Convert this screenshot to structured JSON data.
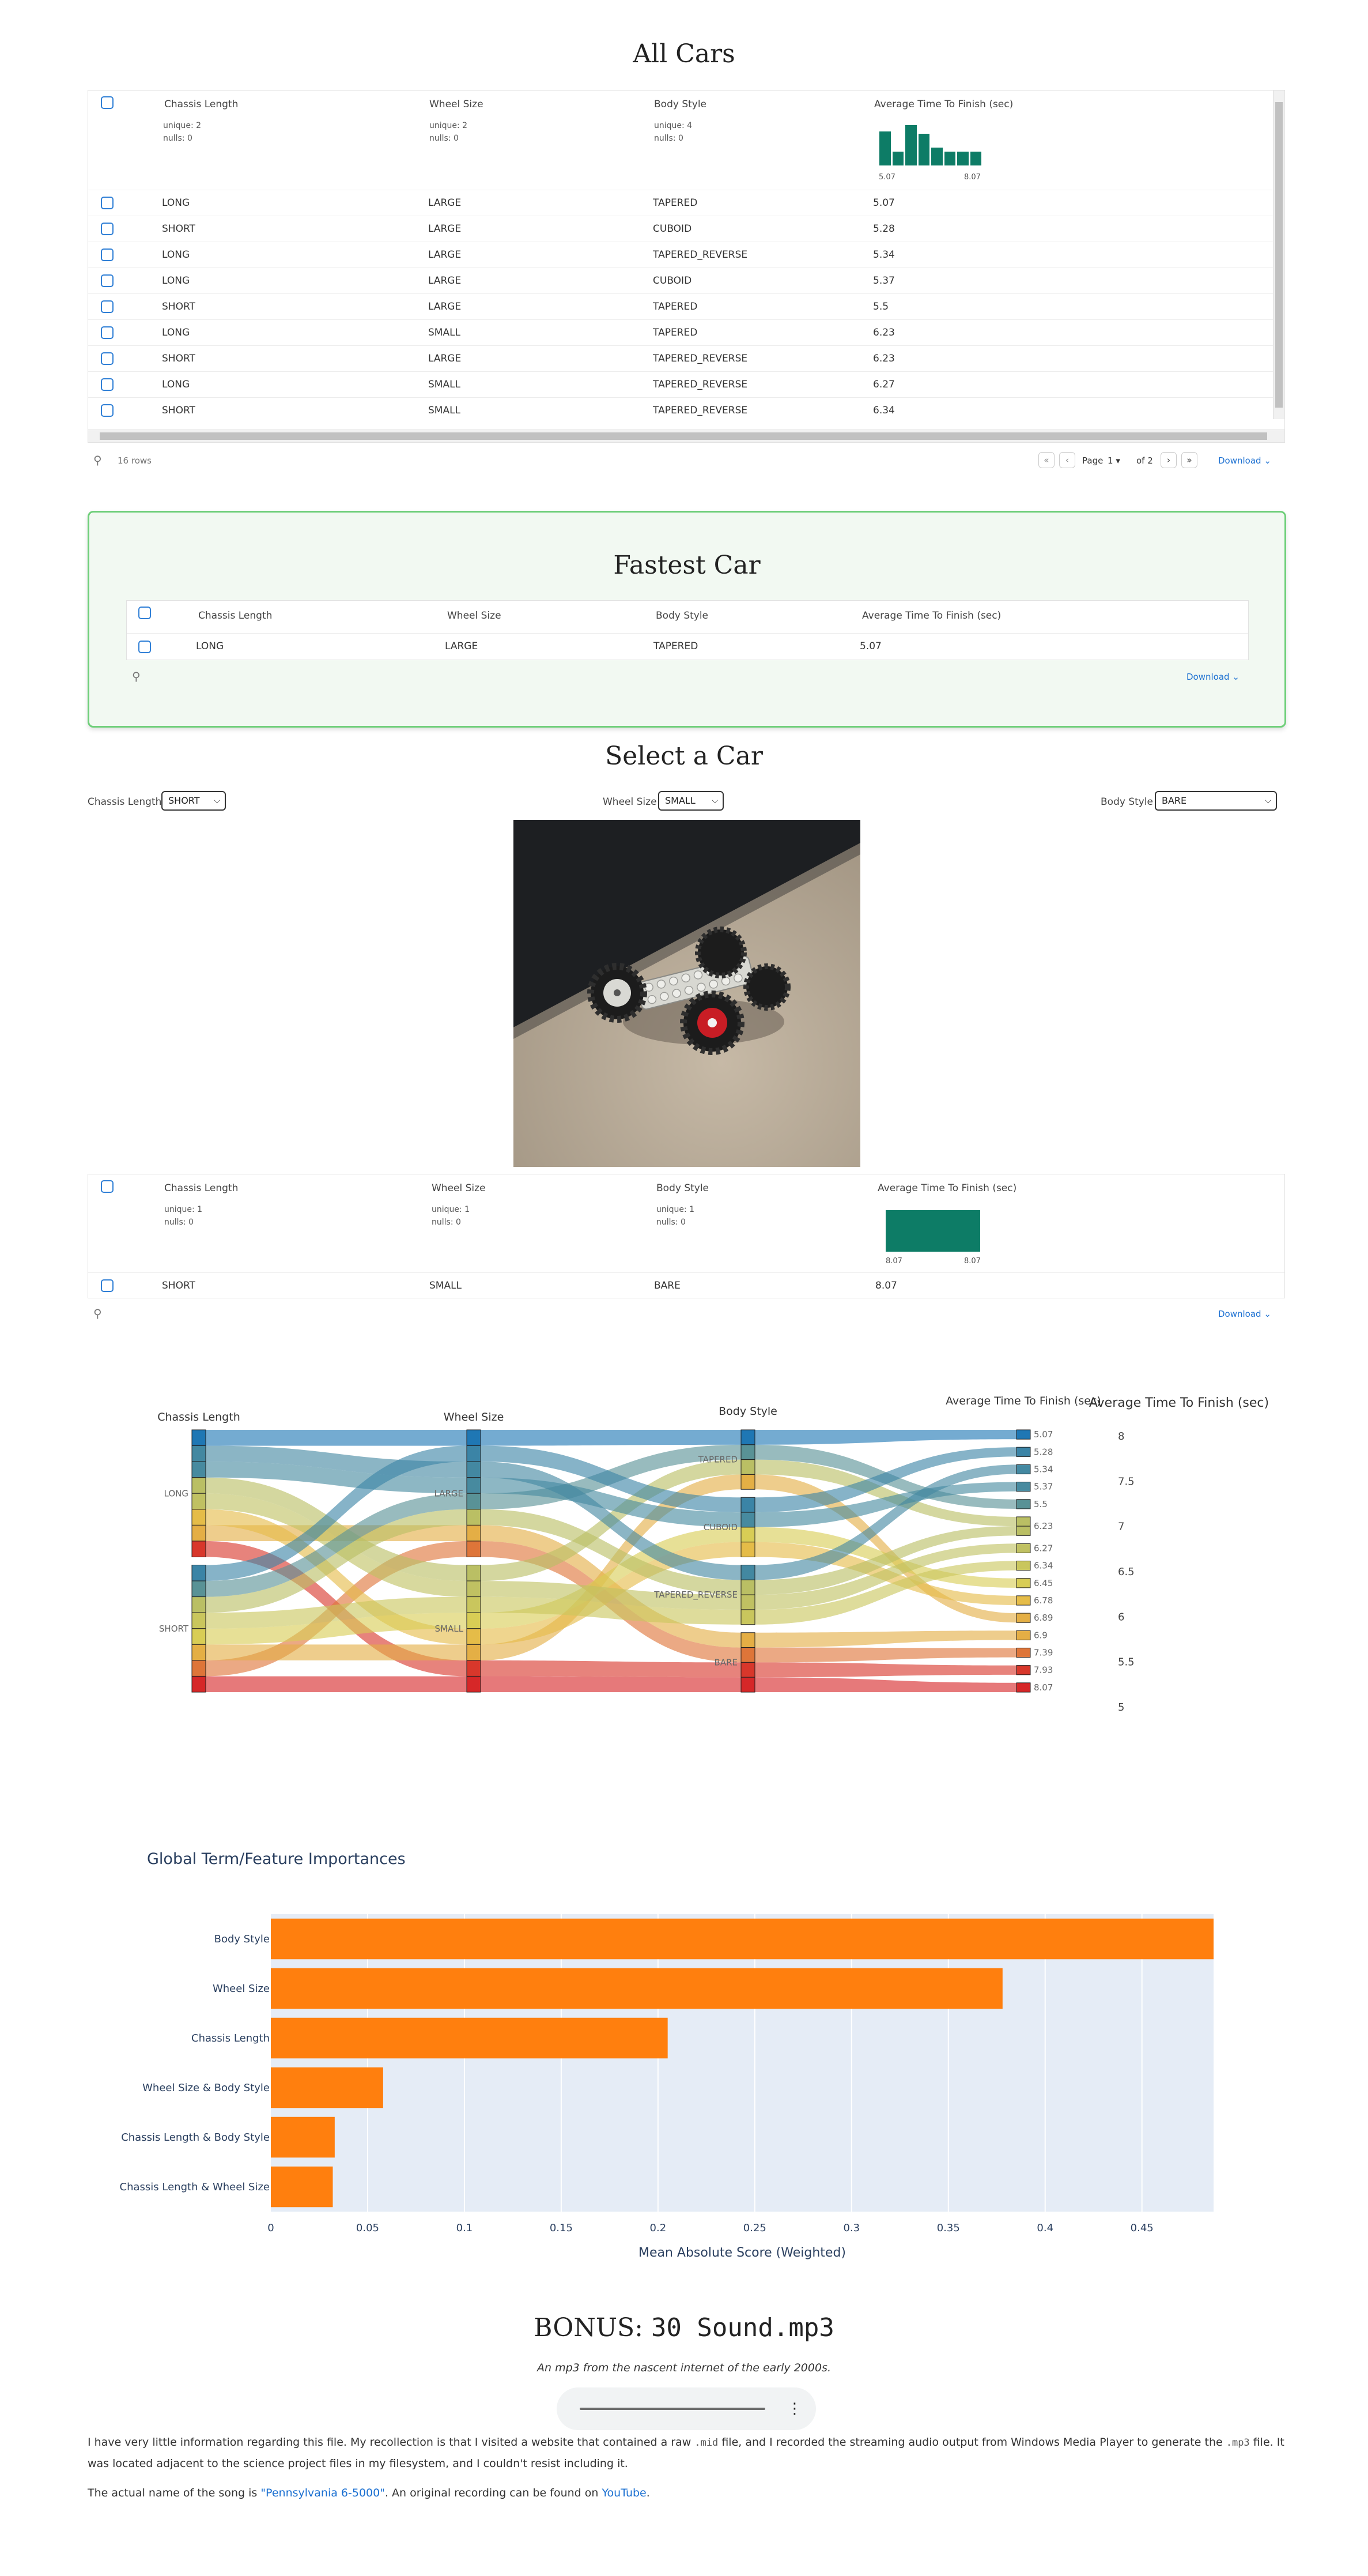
{
  "all_cars": {
    "title": "All Cars",
    "columns": [
      "Chassis Length",
      "Wheel Size",
      "Body Style",
      "Average Time To Finish (sec)"
    ],
    "stats": [
      {
        "unique": "unique: 2",
        "nulls": "nulls: 0"
      },
      {
        "unique": "unique: 2",
        "nulls": "nulls: 0"
      },
      {
        "unique": "unique: 4",
        "nulls": "nulls: 0"
      }
    ],
    "hist_min": "5.07",
    "hist_max": "8.07",
    "hist_bins": [
      0.85,
      0.35,
      1.0,
      0.78,
      0.45,
      0.35,
      0.35,
      0.35
    ],
    "rows": [
      [
        "LONG",
        "LARGE",
        "TAPERED",
        "5.07"
      ],
      [
        "SHORT",
        "LARGE",
        "CUBOID",
        "5.28"
      ],
      [
        "LONG",
        "LARGE",
        "TAPERED_REVERSE",
        "5.34"
      ],
      [
        "LONG",
        "LARGE",
        "CUBOID",
        "5.37"
      ],
      [
        "SHORT",
        "LARGE",
        "TAPERED",
        "5.5"
      ],
      [
        "LONG",
        "SMALL",
        "TAPERED",
        "6.23"
      ],
      [
        "SHORT",
        "LARGE",
        "TAPERED_REVERSE",
        "6.23"
      ],
      [
        "LONG",
        "SMALL",
        "TAPERED_REVERSE",
        "6.27"
      ],
      [
        "SHORT",
        "SMALL",
        "TAPERED_REVERSE",
        "6.34"
      ]
    ],
    "row_count": "16 rows",
    "page_label": "Page",
    "page_value": "1",
    "page_of": "of 2",
    "download": "Download"
  },
  "fastest": {
    "title": "Fastest Car",
    "columns": [
      "Chassis Length",
      "Wheel Size",
      "Body Style",
      "Average Time To Finish (sec)"
    ],
    "rows": [
      [
        "LONG",
        "LARGE",
        "TAPERED",
        "5.07"
      ]
    ],
    "download": "Download"
  },
  "select": {
    "title": "Select a Car",
    "chassis_label": "Chassis Length",
    "chassis_value": "SHORT",
    "wheel_label": "Wheel Size",
    "wheel_value": "SMALL",
    "body_label": "Body Style",
    "body_value": "BARE",
    "columns": [
      "Chassis Length",
      "Wheel Size",
      "Body Style",
      "Average Time To Finish (sec)"
    ],
    "stats": [
      {
        "unique": "unique: 1",
        "nulls": "nulls: 0"
      },
      {
        "unique": "unique: 1",
        "nulls": "nulls: 0"
      },
      {
        "unique": "unique: 1",
        "nulls": "nulls: 0"
      }
    ],
    "hist_min": "8.07",
    "hist_max": "8.07",
    "rows": [
      [
        "SHORT",
        "SMALL",
        "BARE",
        "8.07"
      ]
    ],
    "download": "Download"
  },
  "parcats": {
    "dims": [
      "Chassis Length",
      "Wheel Size",
      "Body Style",
      "Average Time To Finish (sec)"
    ],
    "chassis_cats": [
      "LONG",
      "SHORT"
    ],
    "wheel_cats": [
      "LARGE",
      "SMALL"
    ],
    "body_cats": [
      "TAPERED",
      "CUBOID",
      "TAPERED_REVERSE",
      "BARE"
    ],
    "time_values": [
      "5.07",
      "5.28",
      "5.34",
      "5.37",
      "5.5",
      "6.23",
      "6.27",
      "6.34",
      "6.45",
      "6.78",
      "6.89",
      "6.9",
      "7.39",
      "7.93",
      "8.07"
    ],
    "colorbar_title": "Average Time To Finish (sec)",
    "colorbar_ticks": [
      "8",
      "7.5",
      "7",
      "6.5",
      "6",
      "5.5",
      "5"
    ],
    "colors": {
      "low": "#1f77b4",
      "mid": "#e8d44d",
      "high": "#d62728"
    },
    "records": [
      [
        "LONG",
        "LARGE",
        "TAPERED",
        5.07
      ],
      [
        "SHORT",
        "LARGE",
        "CUBOID",
        5.28
      ],
      [
        "LONG",
        "LARGE",
        "TAPERED_REVERSE",
        5.34
      ],
      [
        "LONG",
        "LARGE",
        "CUBOID",
        5.37
      ],
      [
        "SHORT",
        "LARGE",
        "TAPERED",
        5.5
      ],
      [
        "LONG",
        "SMALL",
        "TAPERED",
        6.23
      ],
      [
        "SHORT",
        "LARGE",
        "TAPERED_REVERSE",
        6.23
      ],
      [
        "LONG",
        "SMALL",
        "TAPERED_REVERSE",
        6.27
      ],
      [
        "SHORT",
        "SMALL",
        "TAPERED_REVERSE",
        6.34
      ],
      [
        "SHORT",
        "SMALL",
        "CUBOID",
        6.45
      ],
      [
        "LONG",
        "SMALL",
        "CUBOID",
        6.78
      ],
      [
        "SHORT",
        "SMALL",
        "TAPERED",
        6.89
      ],
      [
        "LONG",
        "LARGE",
        "BARE",
        6.9
      ],
      [
        "SHORT",
        "LARGE",
        "BARE",
        7.39
      ],
      [
        "LONG",
        "SMALL",
        "BARE",
        7.93
      ],
      [
        "SHORT",
        "SMALL",
        "BARE",
        8.07
      ]
    ]
  },
  "chart_data": {
    "type": "bar",
    "orientation": "horizontal",
    "title": "Global Term/Feature Importances",
    "xlabel": "Mean Absolute Score (Weighted)",
    "ylabel": "",
    "categories": [
      "Body Style",
      "Wheel Size",
      "Chassis Length",
      "Wheel Size & Body Style",
      "Chassis Length & Body Style",
      "Chassis Length & Wheel Size"
    ],
    "values": [
      0.487,
      0.378,
      0.205,
      0.058,
      0.033,
      0.032
    ],
    "xlim": [
      0,
      0.487
    ],
    "xticks": [
      "0",
      "0.05",
      "0.1",
      "0.15",
      "0.2",
      "0.25",
      "0.3",
      "0.35",
      "0.4",
      "0.45"
    ],
    "bar_color": "#ff7f0e",
    "grid": true
  },
  "bonus": {
    "title_prefix": "BONUS: ",
    "title_mono": "30 Sound.mp3",
    "subtitle": "An mp3 from the nascent internet of the early 2000s.",
    "para1_a": "I have very little information regarding this file. My recollection is that I visited a website that contained a raw ",
    "para1_code1": ".mid",
    "para1_b": " file, and I recorded the streaming audio output from Windows Media Player to generate the ",
    "para1_code2": ".mp3",
    "para1_c": " file. It was located adjacent to the science project files in my filesystem, and I couldn't resist including it.",
    "para2_a": "The actual name of the song is ",
    "para2_link1": "\"Pennsylvania 6-5000\"",
    "para2_b": ". An original recording can be found on ",
    "para2_link2": "YouTube",
    "para2_c": "."
  }
}
